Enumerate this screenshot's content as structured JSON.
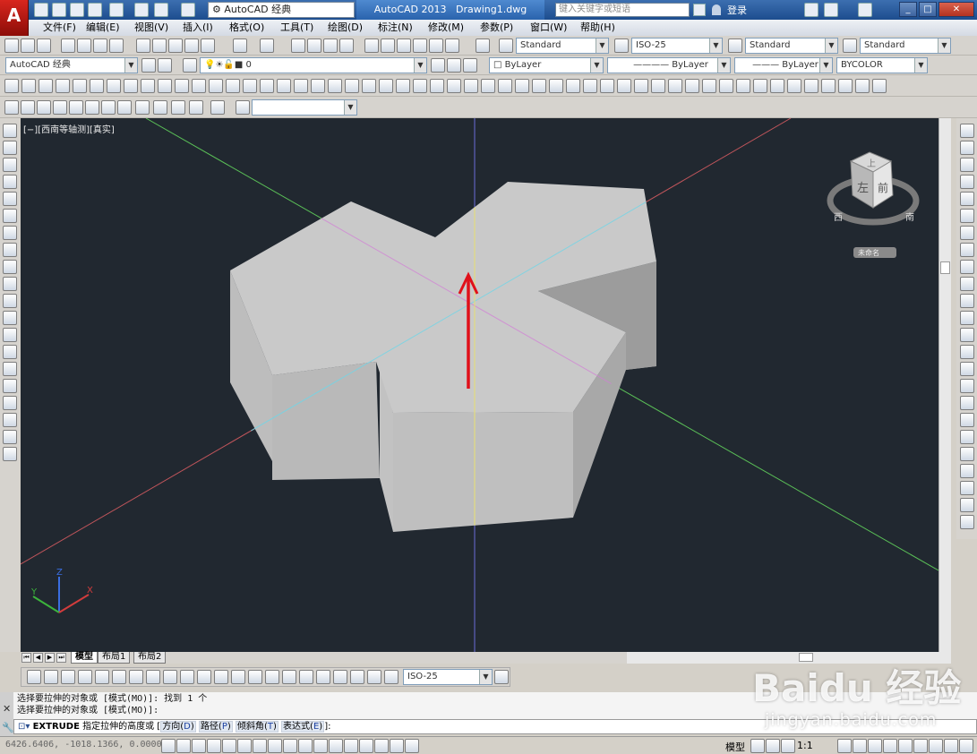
{
  "titlebar": {
    "app_logo": "A",
    "workspace": "AutoCAD 经典",
    "app_name": "AutoCAD 2013",
    "document": "Drawing1.dwg",
    "search_placeholder": "键入关键字或短语",
    "login": "登录"
  },
  "menu": [
    "文件(F)",
    "编辑(E)",
    "视图(V)",
    "插入(I)",
    "格式(O)",
    "工具(T)",
    "绘图(D)",
    "标注(N)",
    "修改(M)",
    "参数(P)",
    "窗口(W)",
    "帮助(H)"
  ],
  "styles_toolbar": {
    "text_style": "Standard",
    "dim_style": "ISO-25",
    "table_style": "Standard",
    "multileader_style": "Standard"
  },
  "layers_toolbar": {
    "workspace": "AutoCAD 经典",
    "layer": "0",
    "color": "ByLayer",
    "linetype": "ByLayer",
    "lineweight": "ByLayer",
    "plotstyle": "BYCOLOR"
  },
  "viewport": {
    "label": "[−][西南等轴测][真实]",
    "viewcube_top": "上",
    "viewcube_left": "左",
    "viewcube_front": "前",
    "compass_west": "西",
    "compass_south": "南",
    "ucs_name": "未命名",
    "ucs_x": "X",
    "ucs_y": "Y",
    "ucs_z": "Z"
  },
  "tabs": [
    "模型",
    "布局1",
    "布局2"
  ],
  "dim_toolbar": {
    "dim_style": "ISO-25"
  },
  "command": {
    "history": [
      "选择要拉伸的对象或 [模式(MO)]: 找到 1 个",
      "选择要拉伸的对象或 [模式(MO)]:"
    ],
    "command_name": "EXTRUDE",
    "prompt": "指定拉伸的高度或",
    "options": [
      {
        "label": "方向",
        "key": "D"
      },
      {
        "label": "路径",
        "key": "P"
      },
      {
        "label": "倾斜角",
        "key": "T"
      },
      {
        "label": "表达式",
        "key": "E"
      }
    ],
    "suffix": "]:"
  },
  "statusbar": {
    "coords": "6426.6406, -1018.1366, 0.0000",
    "model": "模型",
    "scale": "1:1"
  },
  "watermark": {
    "logo": "Baidu 经验",
    "url": "jingyan.baidu.com"
  },
  "colors": {
    "viewport_bg": "#212830",
    "x_axis": "#c0555b",
    "y_axis": "#5abf57",
    "z_axis": "#6b6bd8",
    "annotation_arrow": "#e0101a"
  }
}
